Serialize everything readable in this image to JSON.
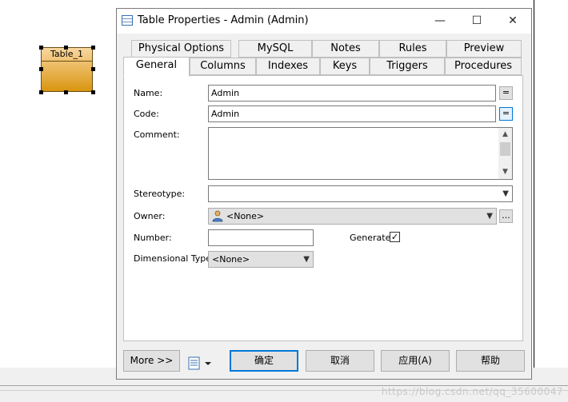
{
  "canvas": {
    "table_symbol_label": "Table_1",
    "watermark": "https://blog.csdn.net/qq_35600047"
  },
  "dialog": {
    "title": "Table Properties - Admin (Admin)",
    "window_controls": {
      "minimize": "—",
      "maximize": "☐",
      "close": "✕"
    },
    "tabs_back_row": [
      "Physical Options",
      "MySQL",
      "Notes",
      "Rules",
      "Preview"
    ],
    "tabs_front_row": [
      "General",
      "Columns",
      "Indexes",
      "Keys",
      "Triggers",
      "Procedures"
    ],
    "active_tab": "General",
    "form": {
      "name_label": "Name:",
      "name_value": "Admin",
      "code_label": "Code:",
      "code_value": "Admin",
      "equals_button": "=",
      "comment_label": "Comment:",
      "comment_value": "",
      "stereotype_label": "Stereotype:",
      "stereotype_value": "",
      "owner_label": "Owner:",
      "owner_value": "<None>",
      "owner_browse": "...",
      "number_label": "Number:",
      "number_value": "",
      "generate_label": "Generate:",
      "generate_checked": "✓",
      "dimensional_type_label": "Dimensional Type:",
      "dimensional_type_value": "<None>"
    },
    "buttons": {
      "more": "More >>",
      "ok": "确定",
      "cancel": "取消",
      "apply": "应用(A)",
      "help": "帮助"
    }
  }
}
